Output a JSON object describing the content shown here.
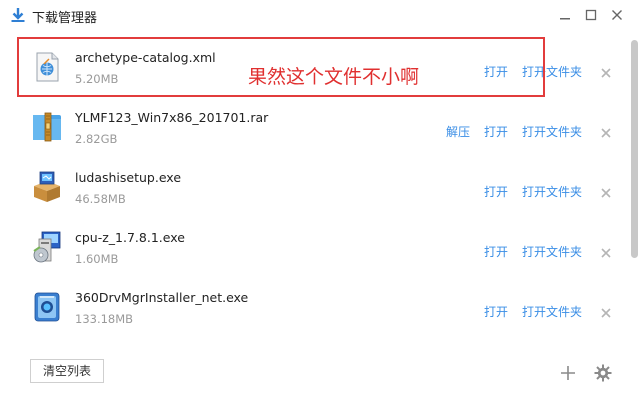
{
  "window": {
    "title": "下载管理器",
    "icon": "download-icon",
    "controls": [
      "minimize-icon",
      "maximize-icon",
      "close-icon"
    ]
  },
  "files": [
    {
      "name": "archetype-catalog.xml",
      "size": "5.20MB",
      "icon": "xml-file-icon",
      "actions": {
        "open": "打开",
        "folder": "打开文件夹"
      }
    },
    {
      "name": "YLMF123_Win7x86_201701.rar",
      "size": "2.82GB",
      "icon": "rar-archive-icon",
      "actions": {
        "extract": "解压",
        "open": "打开",
        "folder": "打开文件夹"
      }
    },
    {
      "name": "ludashisetup.exe",
      "size": "46.58MB",
      "icon": "installer-box-icon",
      "actions": {
        "open": "打开",
        "folder": "打开文件夹"
      }
    },
    {
      "name": "cpu-z_1.7.8.1.exe",
      "size": "1.60MB",
      "icon": "cpu-z-installer-icon",
      "actions": {
        "open": "打开",
        "folder": "打开文件夹"
      }
    },
    {
      "name": "360DrvMgrInstaller_net.exe",
      "size": "133.18MB",
      "icon": "360-driver-icon",
      "actions": {
        "open": "打开",
        "folder": "打开文件夹"
      }
    }
  ],
  "annotation": {
    "text": "果然这个文件不小啊",
    "color": "#e03030"
  },
  "footer": {
    "clear_label": "清空列表",
    "icons": [
      "add-icon",
      "settings-icon"
    ]
  },
  "colors": {
    "link": "#3a8ee6",
    "highlight": "#e23c3c",
    "size_text": "#9a9a9a"
  }
}
